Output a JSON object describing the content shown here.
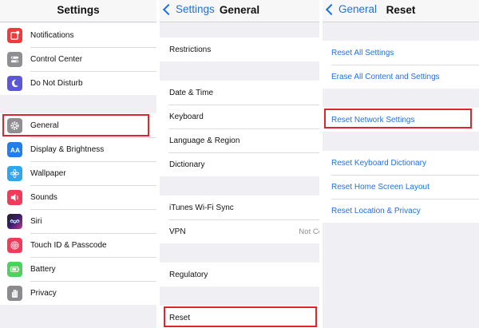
{
  "colors": {
    "highlight": "#dc2530",
    "link": "#1d72e8",
    "background": "#efeff4"
  },
  "panel1": {
    "title": "Settings",
    "groups": [
      {
        "items": [
          {
            "label": "Notifications",
            "icon": "notifications-icon"
          },
          {
            "label": "Control Center",
            "icon": "control-center-icon"
          },
          {
            "label": "Do Not Disturb",
            "icon": "moon-icon"
          }
        ]
      },
      {
        "items": [
          {
            "label": "General",
            "icon": "gear-icon"
          },
          {
            "label": "Display & Brightness",
            "icon": "display-icon"
          },
          {
            "label": "Wallpaper",
            "icon": "wallpaper-icon"
          },
          {
            "label": "Sounds",
            "icon": "speaker-icon"
          },
          {
            "label": "Siri",
            "icon": "siri-icon"
          },
          {
            "label": "Touch ID & Passcode",
            "icon": "fingerprint-icon"
          },
          {
            "label": "Battery",
            "icon": "battery-icon"
          },
          {
            "label": "Privacy",
            "icon": "hand-icon"
          }
        ]
      }
    ]
  },
  "panel2": {
    "back": "Settings",
    "title": "General",
    "groups": [
      {
        "items": [
          {
            "label": "Restrictions"
          }
        ]
      },
      {
        "items": [
          {
            "label": "Date & Time"
          },
          {
            "label": "Keyboard"
          },
          {
            "label": "Language & Region"
          },
          {
            "label": "Dictionary"
          }
        ]
      },
      {
        "items": [
          {
            "label": "iTunes Wi-Fi Sync"
          },
          {
            "label": "VPN",
            "detail": "Not Co"
          }
        ]
      },
      {
        "items": [
          {
            "label": "Regulatory"
          }
        ]
      },
      {
        "items": [
          {
            "label": "Reset"
          }
        ]
      }
    ]
  },
  "panel3": {
    "back": "General",
    "title": "Reset",
    "groups": [
      {
        "items": [
          {
            "label": "Reset All Settings"
          },
          {
            "label": "Erase All Content and Settings"
          }
        ]
      },
      {
        "items": [
          {
            "label": "Reset Network Settings"
          }
        ]
      },
      {
        "items": [
          {
            "label": "Reset Keyboard Dictionary"
          },
          {
            "label": "Reset Home Screen Layout"
          },
          {
            "label": "Reset Location & Privacy"
          }
        ]
      }
    ]
  }
}
